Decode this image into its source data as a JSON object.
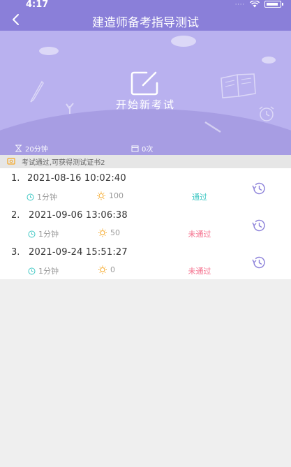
{
  "status_bar": {
    "time": "4:17",
    "signal_dots": "····"
  },
  "navbar": {
    "title": "建造师备考指导测试",
    "back_icon": "chevron-left-icon"
  },
  "hero": {
    "start_label": "开始新考试",
    "start_icon": "edit-square-icon",
    "duration": "20分钟",
    "attempts": "0次"
  },
  "notice": {
    "text": "考试通过,可获得测试证书2",
    "icon": "certificate-icon"
  },
  "colors": {
    "primary": "#8a7fd9",
    "hero_bg": "#b9b1ef",
    "pass": "#3cc7c3",
    "fail": "#f56f8c",
    "clock": "#3cc7c3",
    "score": "#f5a623"
  },
  "records": [
    {
      "index": "1.",
      "datetime": "2021-08-16 10:02:40",
      "duration": "1分钟",
      "score": "100",
      "result": "通过",
      "passed": true
    },
    {
      "index": "2.",
      "datetime": "2021-09-06 13:06:38",
      "duration": "1分钟",
      "score": "50",
      "result": "未通过",
      "passed": false
    },
    {
      "index": "3.",
      "datetime": "2021-09-24 15:51:27",
      "duration": "1分钟",
      "score": "0",
      "result": "未通过",
      "passed": false
    }
  ]
}
